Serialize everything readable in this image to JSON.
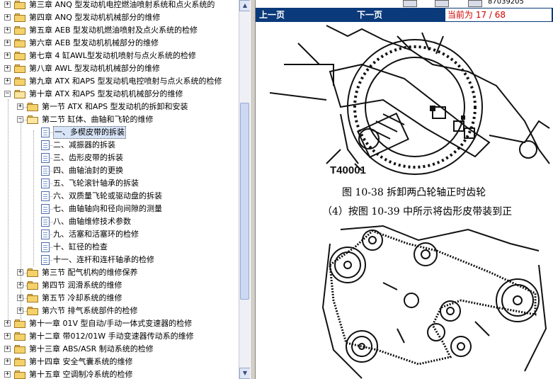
{
  "tree": {
    "items": [
      {
        "label": "第三章  ANQ 型发动机电控燃油喷射系统和点火系统的",
        "level": 0,
        "expander": "+",
        "icon": "folder"
      },
      {
        "label": "第四章  ANQ 型发动机机械部分的维修",
        "level": 0,
        "expander": "+",
        "icon": "folder"
      },
      {
        "label": "第五章  AEB 型发动机燃油喷射及点火系统的检修",
        "level": 0,
        "expander": "+",
        "icon": "folder"
      },
      {
        "label": "第六章  AEB 型发动机机械部分的维修",
        "level": 0,
        "expander": "+",
        "icon": "folder"
      },
      {
        "label": "第七章  4 缸AWL型发动机喷射与点火系统的检修",
        "level": 0,
        "expander": "+",
        "icon": "folder"
      },
      {
        "label": "第八章  AWL 型发动机机械部分的维修",
        "level": 0,
        "expander": "+",
        "icon": "folder"
      },
      {
        "label": "第九章  ATX 和APS 型发动机电控喷射与点火系统的检修",
        "level": 0,
        "expander": "+",
        "icon": "folder"
      },
      {
        "label": "第十章  ATX 和APS 型发动机机械部分的维修",
        "level": 0,
        "expander": "-",
        "icon": "folder-open"
      },
      {
        "label": "第一节  ATX 和APS 型发动机的拆卸和安装",
        "level": 1,
        "expander": "+",
        "icon": "folder"
      },
      {
        "label": "第二节  缸体、曲轴和飞轮的维修",
        "level": 1,
        "expander": "-",
        "icon": "folder-open"
      },
      {
        "label": "一、多楔皮带的拆装",
        "level": 2,
        "expander": "",
        "icon": "doc",
        "selected": true
      },
      {
        "label": "二、减振器的拆装",
        "level": 2,
        "expander": "",
        "icon": "doc"
      },
      {
        "label": "三、齿形皮带的拆装",
        "level": 2,
        "expander": "",
        "icon": "doc"
      },
      {
        "label": "四、曲轴油封的更换",
        "level": 2,
        "expander": "",
        "icon": "doc"
      },
      {
        "label": "五、飞轮滚针轴承的拆装",
        "level": 2,
        "expander": "",
        "icon": "doc"
      },
      {
        "label": "六、双质量飞轮或驱动盘的拆装",
        "level": 2,
        "expander": "",
        "icon": "doc"
      },
      {
        "label": "七、曲轴轴向和径向间隙的测量",
        "level": 2,
        "expander": "",
        "icon": "doc"
      },
      {
        "label": "八、曲轴维修技术参数",
        "level": 2,
        "expander": "",
        "icon": "doc"
      },
      {
        "label": "九、活塞和活塞环的检修",
        "level": 2,
        "expander": "",
        "icon": "doc"
      },
      {
        "label": "十、缸径的检查",
        "level": 2,
        "expander": "",
        "icon": "doc"
      },
      {
        "label": "十一、连杆和连杆轴承的检修",
        "level": 2,
        "expander": "",
        "icon": "doc"
      },
      {
        "label": "第三节  配气机构的维修保养",
        "level": 1,
        "expander": "+",
        "icon": "folder"
      },
      {
        "label": "第四节  润滑系统的维修",
        "level": 1,
        "expander": "+",
        "icon": "folder"
      },
      {
        "label": "第五节  冷却系统的维修",
        "level": 1,
        "expander": "+",
        "icon": "folder"
      },
      {
        "label": "第六节  排气系统部件的检修",
        "level": 1,
        "expander": "+",
        "icon": "folder"
      },
      {
        "label": "第十一章  01V 型自动/手动一体式变速器的检修",
        "level": 0,
        "expander": "+",
        "icon": "folder"
      },
      {
        "label": "第十二章  带012/01W 手动变速器传动系的维修",
        "level": 0,
        "expander": "+",
        "icon": "folder"
      },
      {
        "label": "第十三章  ABS/ASR 制动系统的检修",
        "level": 0,
        "expander": "+",
        "icon": "folder"
      },
      {
        "label": "第十四章  安全气囊系统的维修",
        "level": 0,
        "expander": "+",
        "icon": "folder"
      },
      {
        "label": "第十五章  空调制冷系统的检修",
        "level": 0,
        "expander": "+",
        "icon": "folder"
      }
    ]
  },
  "viewer": {
    "top_code": "87039205",
    "prev_label": "上一页",
    "next_label": "下一页",
    "page_info": "当前为  17 / 68",
    "figure_tag": "T40001",
    "figure_caption": "图 10-38    拆卸两凸轮轴正时齿轮",
    "body_text": "（4）按图 10-39 中所示将齿形皮带装到正"
  },
  "colors": {
    "navbar_bg": "#0a3a7a",
    "page_info_text": "#d00000",
    "selection_bg": "#d8e4f8"
  }
}
